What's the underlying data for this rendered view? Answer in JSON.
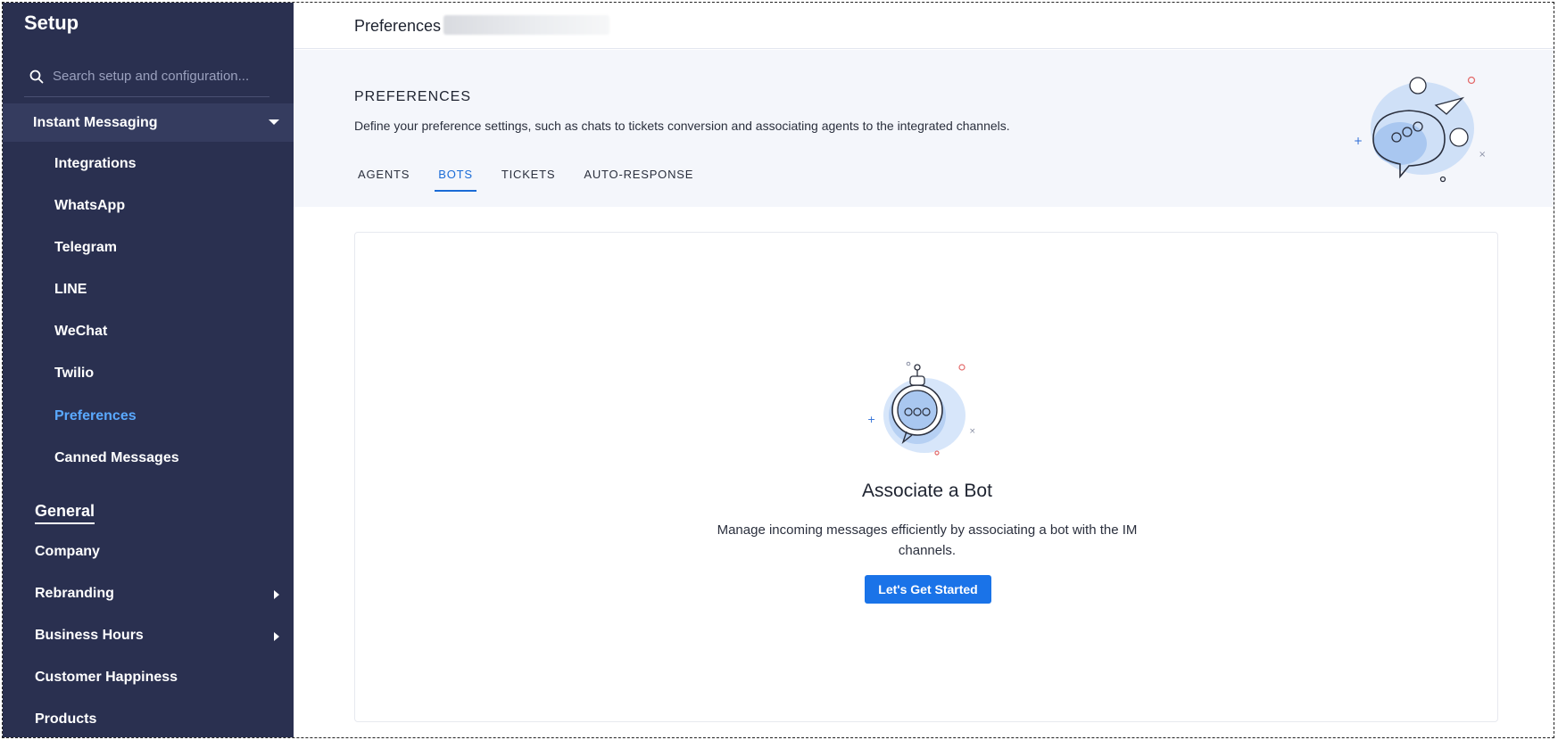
{
  "sidebar": {
    "title": "Setup",
    "search_placeholder": "Search setup and configuration...",
    "section": "Instant Messaging",
    "items": [
      {
        "label": "Integrations"
      },
      {
        "label": "WhatsApp"
      },
      {
        "label": "Telegram"
      },
      {
        "label": "LINE"
      },
      {
        "label": "WeChat"
      },
      {
        "label": "Twilio"
      },
      {
        "label": "Preferences",
        "active": true
      },
      {
        "label": "Canned Messages"
      }
    ],
    "general": {
      "title": "General",
      "items": [
        {
          "label": "Company"
        },
        {
          "label": "Rebranding"
        },
        {
          "label": "Business Hours"
        },
        {
          "label": "Customer Happiness"
        },
        {
          "label": "Products"
        }
      ]
    }
  },
  "topbar": {
    "crumb": "Preferences"
  },
  "header": {
    "title": "PREFERENCES",
    "description": "Define your preference settings, such as chats to tickets conversion and associating agents to the integrated channels.",
    "tabs": [
      {
        "label": "AGENTS"
      },
      {
        "label": "BOTS",
        "active": true
      },
      {
        "label": "TICKETS"
      },
      {
        "label": "AUTO-RESPONSE"
      }
    ]
  },
  "card": {
    "title": "Associate a Bot",
    "description": "Manage incoming messages efficiently by associating a bot with the IM channels.",
    "button": "Let's Get Started"
  },
  "colors": {
    "sidebar_bg": "#2a3050",
    "active_link": "#5aa9ff",
    "accent": "#1a73e8"
  }
}
